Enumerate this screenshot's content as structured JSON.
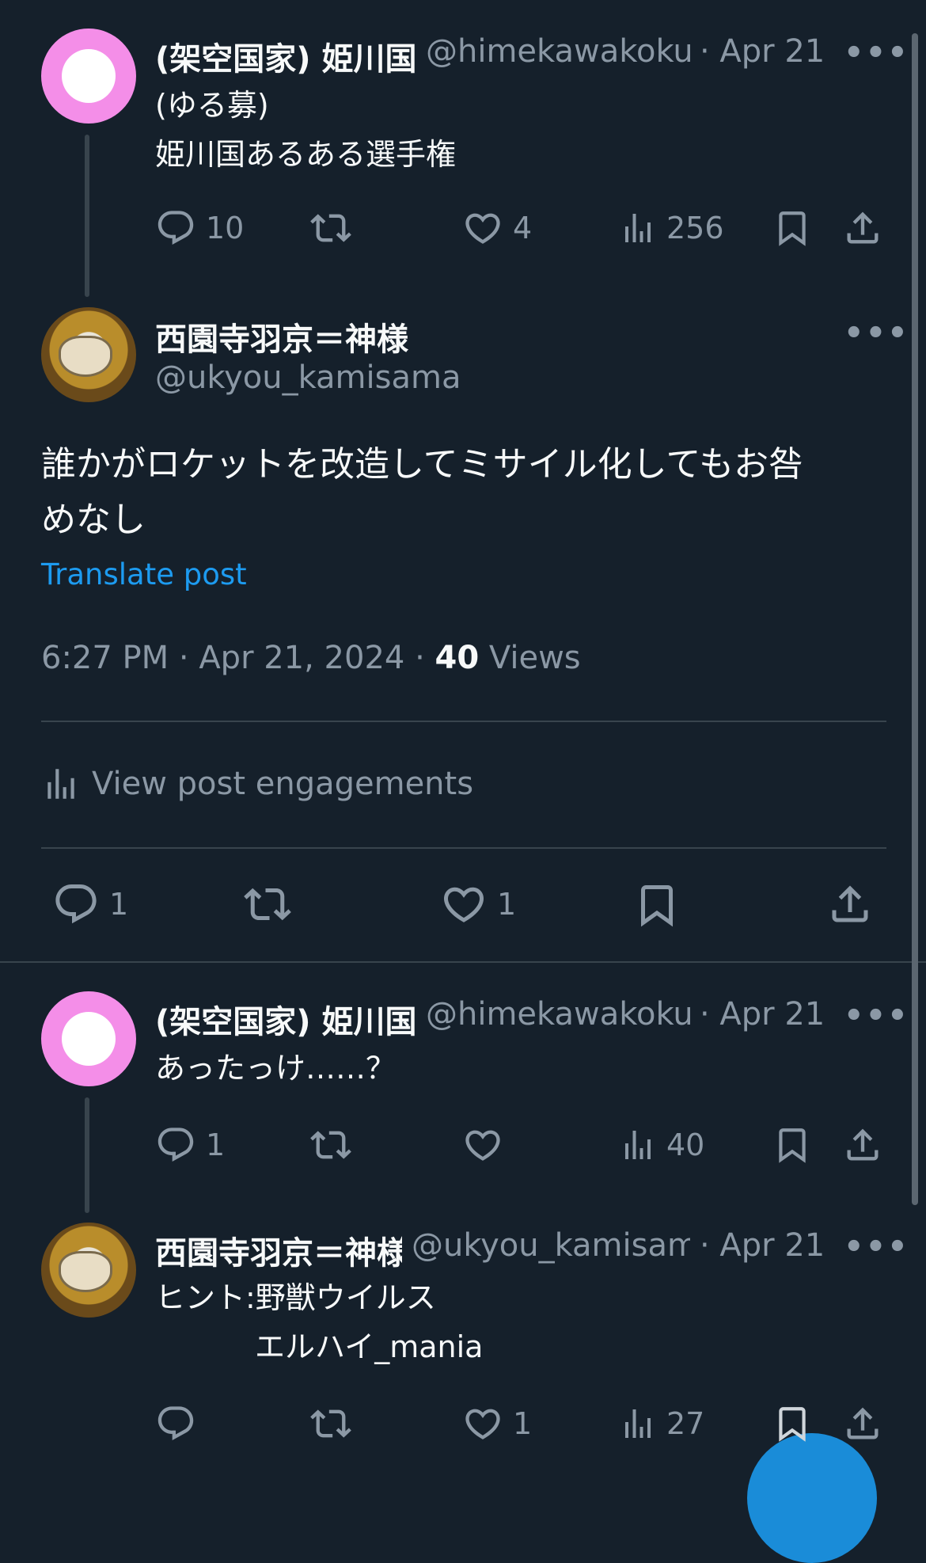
{
  "tweet1": {
    "name": "(架空国家) 姫川国",
    "handle": "@himekawakoku",
    "date": "· Apr 21",
    "line1": "(ゆる募)",
    "line2": "姫川国あるある選手権",
    "replies": "10",
    "likes": "4",
    "views": "256"
  },
  "main": {
    "name": "西園寺羽京＝神様",
    "handle": "@ukyou_kamisama",
    "text_line1": "誰かがロケットを改造してミサイル化してもお咎",
    "text_line2": "めなし",
    "translate": "Translate post",
    "timestamp": "6:27 PM · Apr 21, 2024 · ",
    "views_count": "40",
    "views_label": " Views",
    "engagements": "View post engagements",
    "replies": "1",
    "likes": "1"
  },
  "reply1": {
    "name": "(架空国家) 姫川国",
    "handle": "@himekawakoku",
    "date": "· Apr 21",
    "text": "あったっけ……？",
    "replies": "1",
    "views": "40"
  },
  "reply2": {
    "name": "西園寺羽京＝神様",
    "handle": "@ukyou_kamisama",
    "date": "· Apr 21",
    "line1": "ヒント:野獣ウイルス",
    "line2": "エルハイ_mania",
    "likes": "1",
    "views": "27"
  },
  "more_label": "•••",
  "colors": {
    "accent": "#1d9bf0",
    "background": "#15202b",
    "muted": "#8b98a5"
  }
}
